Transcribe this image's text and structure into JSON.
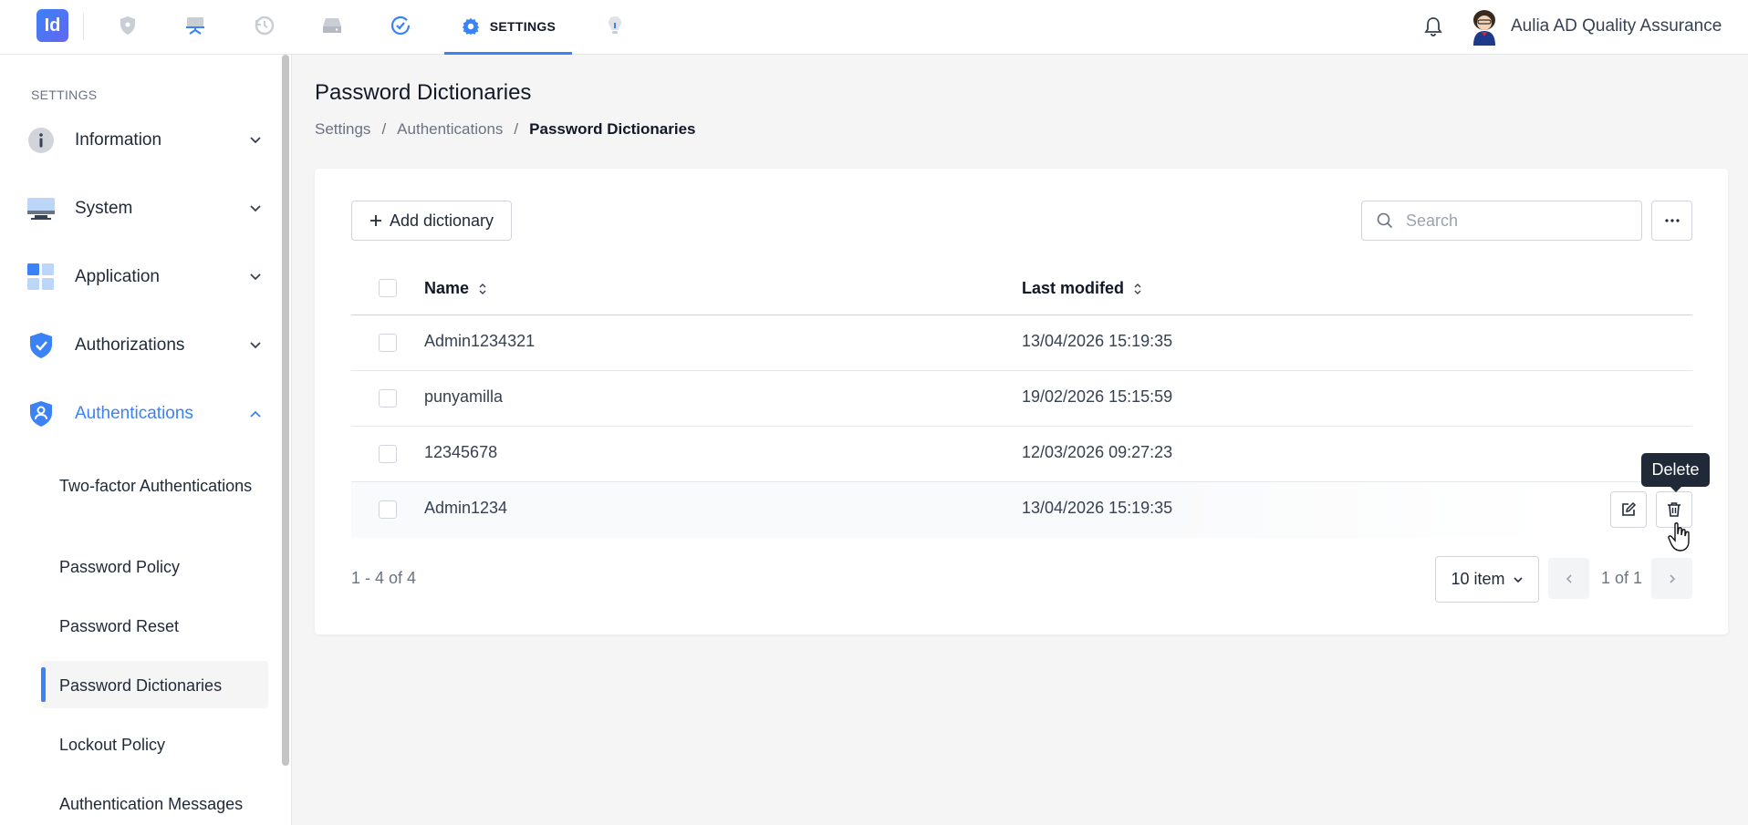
{
  "app": {
    "logo_text": "Id",
    "active_tab_label": "SETTINGS",
    "user_name": "Aulia AD Quality Assurance"
  },
  "nav_icons": [
    "shield-icon",
    "monitor-icon",
    "history-icon",
    "drive-icon",
    "check-circle-icon",
    "settings-gear-icon",
    "lightbulb-icon"
  ],
  "sidebar": {
    "title": "SETTINGS",
    "items": [
      {
        "label": "Information",
        "icon": "info-icon",
        "expanded": false
      },
      {
        "label": "System",
        "icon": "system-monitor-icon",
        "expanded": false
      },
      {
        "label": "Application",
        "icon": "application-grid-icon",
        "expanded": false
      },
      {
        "label": "Authorizations",
        "icon": "shield-check-icon",
        "expanded": false
      },
      {
        "label": "Authentications",
        "icon": "shield-user-icon",
        "expanded": true
      }
    ],
    "sub_items": [
      {
        "label": "Two-factor Authentications"
      },
      {
        "label": "Password Policy"
      },
      {
        "label": "Password Reset"
      },
      {
        "label": "Password Dictionaries",
        "active": true
      },
      {
        "label": "Lockout Policy"
      },
      {
        "label": "Authentication Messages"
      }
    ]
  },
  "page": {
    "title": "Password Dictionaries",
    "breadcrumb": [
      "Settings",
      "Authentications",
      "Password Dictionaries"
    ]
  },
  "toolbar": {
    "add_label": "Add dictionary",
    "search_placeholder": "Search"
  },
  "table": {
    "columns": [
      "Name",
      "Last modifed"
    ],
    "rows": [
      {
        "name": "Admin1234321",
        "modified": "13/04/2026 15:19:35"
      },
      {
        "name": "punyamilla",
        "modified": "19/02/2026 15:15:59"
      },
      {
        "name": "12345678",
        "modified": "12/03/2026 09:27:23"
      },
      {
        "name": "Admin1234",
        "modified": "13/04/2026 15:19:35"
      }
    ],
    "tooltip": "Delete"
  },
  "pagination": {
    "count_text": "1 - 4 of 4",
    "per_page": "10 item",
    "page_text": "1 of 1"
  },
  "colors": {
    "accent": "#3b82f6",
    "text": "#1f2937",
    "muted": "#6b7280",
    "border": "#d1d5db"
  }
}
